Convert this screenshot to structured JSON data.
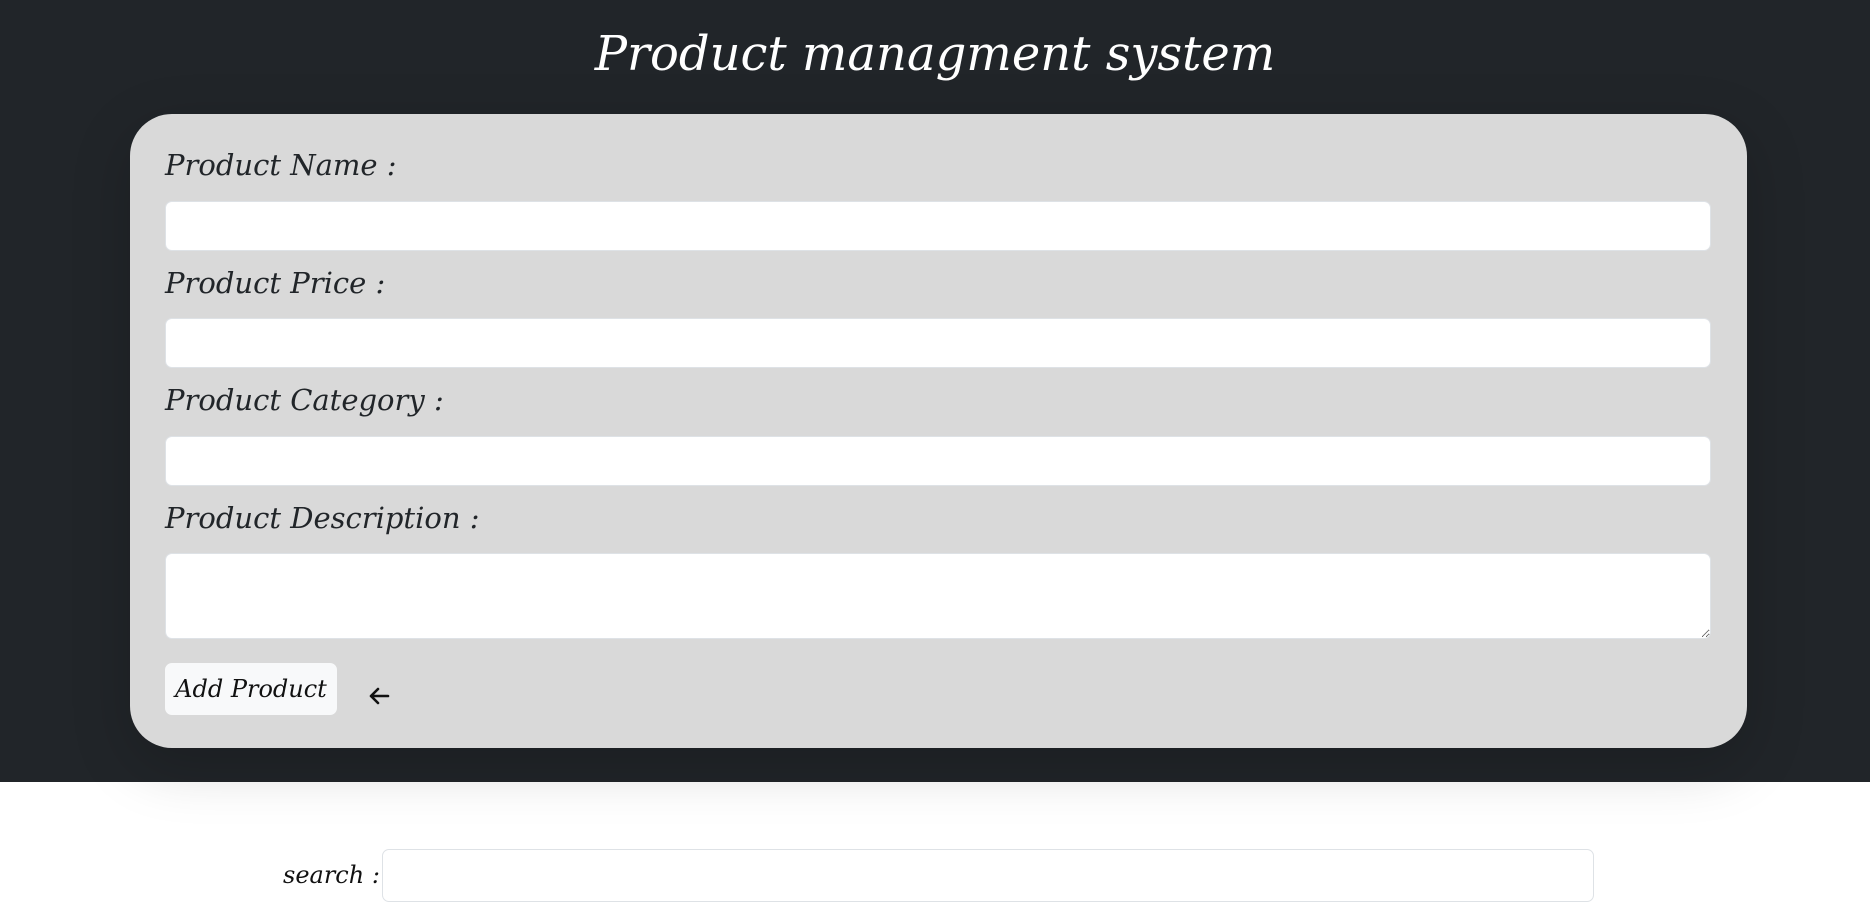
{
  "header": {
    "title": "Product managment system"
  },
  "form": {
    "name_label": "Product Name :",
    "name_value": "",
    "price_label": "Product Price :",
    "price_value": "",
    "category_label": "Product Category :",
    "category_value": "",
    "description_label": "Product Description :",
    "description_value": "",
    "submit_label": "Add Product",
    "back_icon": "arrow-left-icon"
  },
  "search": {
    "label": "search :",
    "value": ""
  },
  "colors": {
    "header_background": "#212529",
    "card_background": "#d9d9d9",
    "button_background": "#f8f9fa"
  }
}
